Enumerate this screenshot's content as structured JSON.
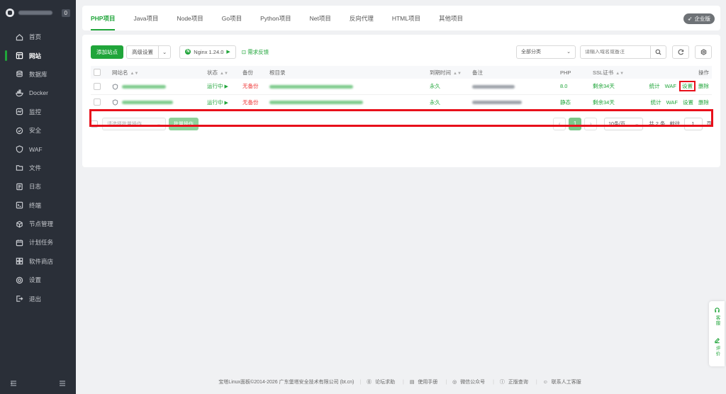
{
  "sidebar": {
    "badge": "0",
    "items": [
      {
        "label": "首页",
        "icon": "home-icon"
      },
      {
        "label": "网站",
        "icon": "website-icon",
        "active": true
      },
      {
        "label": "数据库",
        "icon": "database-icon"
      },
      {
        "label": "Docker",
        "icon": "docker-icon"
      },
      {
        "label": "监控",
        "icon": "monitor-icon"
      },
      {
        "label": "安全",
        "icon": "shield-icon"
      },
      {
        "label": "WAF",
        "icon": "waf-icon"
      },
      {
        "label": "文件",
        "icon": "folder-icon"
      },
      {
        "label": "日志",
        "icon": "log-icon"
      },
      {
        "label": "终端",
        "icon": "terminal-icon"
      },
      {
        "label": "节点管理",
        "icon": "node-icon"
      },
      {
        "label": "计划任务",
        "icon": "calendar-icon"
      },
      {
        "label": "软件商店",
        "icon": "store-icon"
      },
      {
        "label": "设置",
        "icon": "gear-icon"
      },
      {
        "label": "退出",
        "icon": "logout-icon"
      }
    ]
  },
  "tabs": [
    "PHP项目",
    "Java项目",
    "Node项目",
    "Go项目",
    "Python项目",
    "Net项目",
    "反向代理",
    "HTML项目",
    "其他项目"
  ],
  "active_tab": 0,
  "enterprise_badge": "企业版",
  "toolbar": {
    "add_site": "添加站点",
    "advanced": "高级设置",
    "nginx": "Nginx 1.24.0",
    "feedback": "需求反馈",
    "category": "全部分类",
    "search_placeholder": "请输入域名或备注"
  },
  "table": {
    "headers": {
      "name": "网站名",
      "status": "状态",
      "backup": "备份",
      "root": "根目录",
      "expire": "到期时间",
      "remark": "备注",
      "php": "PHP",
      "ssl": "SSL证书",
      "ops": "操作"
    },
    "rows": [
      {
        "status": "运行中",
        "backup": "无备份",
        "expire": "永久",
        "php": "8.0",
        "ssl": "剩余34天",
        "ops": [
          "统计",
          "WAF",
          "设置",
          "删除"
        ],
        "highlight": true
      },
      {
        "status": "运行中",
        "backup": "无备份",
        "expire": "永久",
        "php": "静态",
        "ssl": "剩余34天",
        "ops": [
          "统计",
          "WAF",
          "设置",
          "删除"
        ],
        "highlight": false
      }
    ]
  },
  "batch": {
    "placeholder": "请选择批量操作",
    "execute": "批量操作"
  },
  "pager": {
    "current": "1",
    "per_page": "10条/页",
    "total": "共 2 条",
    "goto_label": "前往",
    "goto_value": "1",
    "page_unit": "页"
  },
  "footer": {
    "copyright": "宝塔Linux面板©2014-2026 广东堡塔安全技术有限公司 (bt.cn)",
    "links": [
      "论坛求助",
      "使用手册",
      "微信公众号",
      "正版查询",
      "联系人工客服"
    ]
  },
  "float_widget": [
    "客服",
    "评价"
  ],
  "colors": {
    "accent": "#20a53a",
    "highlight": "#e8101b",
    "sidebar": "#2a2f38",
    "danger": "#ef3b3b"
  }
}
